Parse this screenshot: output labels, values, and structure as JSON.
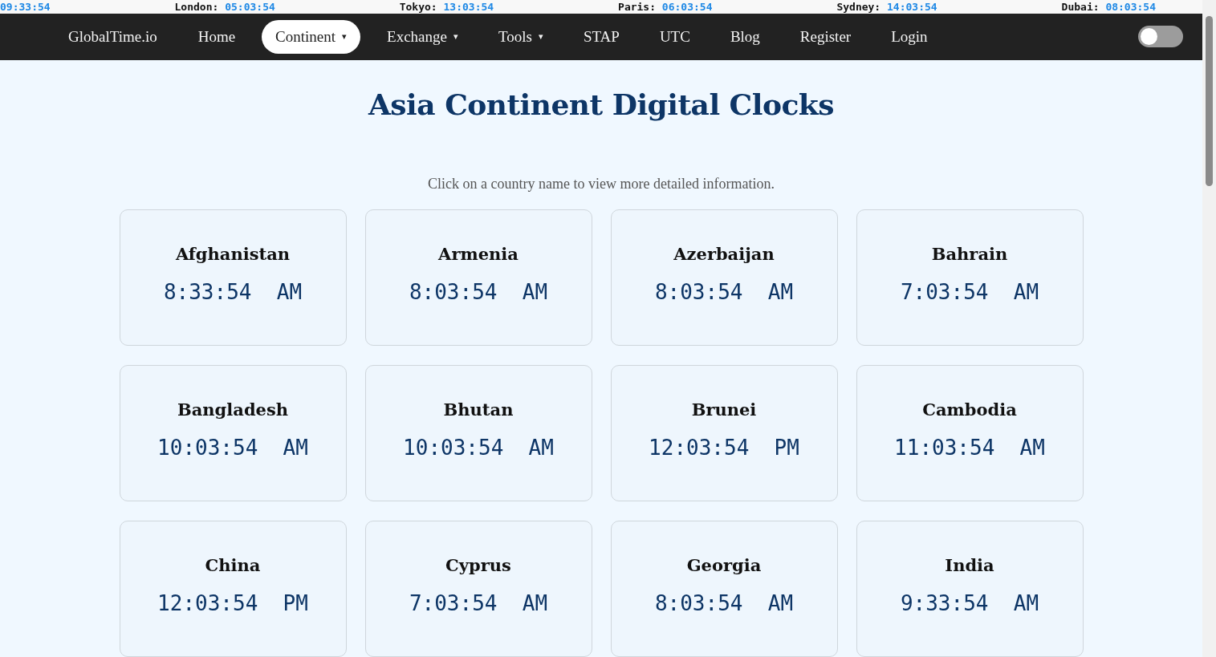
{
  "ticker": [
    {
      "time": "09:33:54"
    },
    {
      "city": "London:",
      "time": "05:03:54"
    },
    {
      "city": "Tokyo:",
      "time": "13:03:54"
    },
    {
      "city": "Paris:",
      "time": "06:03:54"
    },
    {
      "city": "Sydney:",
      "time": "14:03:54"
    },
    {
      "city": "Dubai:",
      "time": "08:03:54"
    }
  ],
  "nav": {
    "logo": "GlobalTime.io",
    "items": [
      {
        "label": "Home",
        "selected": false
      },
      {
        "label": "Continent",
        "caret": "▾",
        "selected": true
      },
      {
        "label": "Exchange",
        "caret": "▾",
        "selected": false
      },
      {
        "label": "Tools",
        "caret": "▾",
        "selected": false
      },
      {
        "label": "STAP",
        "selected": false
      },
      {
        "label": "UTC",
        "selected": false
      },
      {
        "label": "Blog",
        "selected": false
      },
      {
        "label": "Register",
        "selected": false
      },
      {
        "label": "Login",
        "selected": false
      }
    ],
    "theme_toggle": {
      "on": false
    }
  },
  "title": "Asia Continent Digital Clocks",
  "subtitle": "Click on a country name to view more detailed information.",
  "clocks": [
    {
      "country": "Afghanistan",
      "time": "8:33:54 AM"
    },
    {
      "country": "Armenia",
      "time": "8:03:54 AM"
    },
    {
      "country": "Azerbaijan",
      "time": "8:03:54 AM"
    },
    {
      "country": "Bahrain",
      "time": "7:03:54 AM"
    },
    {
      "country": "Bangladesh",
      "time": "10:03:54 AM"
    },
    {
      "country": "Bhutan",
      "time": "10:03:54 AM"
    },
    {
      "country": "Brunei",
      "time": "12:03:54 PM"
    },
    {
      "country": "Cambodia",
      "time": "11:03:54 AM"
    },
    {
      "country": "China",
      "time": "12:03:54 PM"
    },
    {
      "country": "Cyprus",
      "time": "7:03:54 AM"
    },
    {
      "country": "Georgia",
      "time": "8:03:54 AM"
    },
    {
      "country": "India",
      "time": "9:33:54 AM"
    }
  ]
}
